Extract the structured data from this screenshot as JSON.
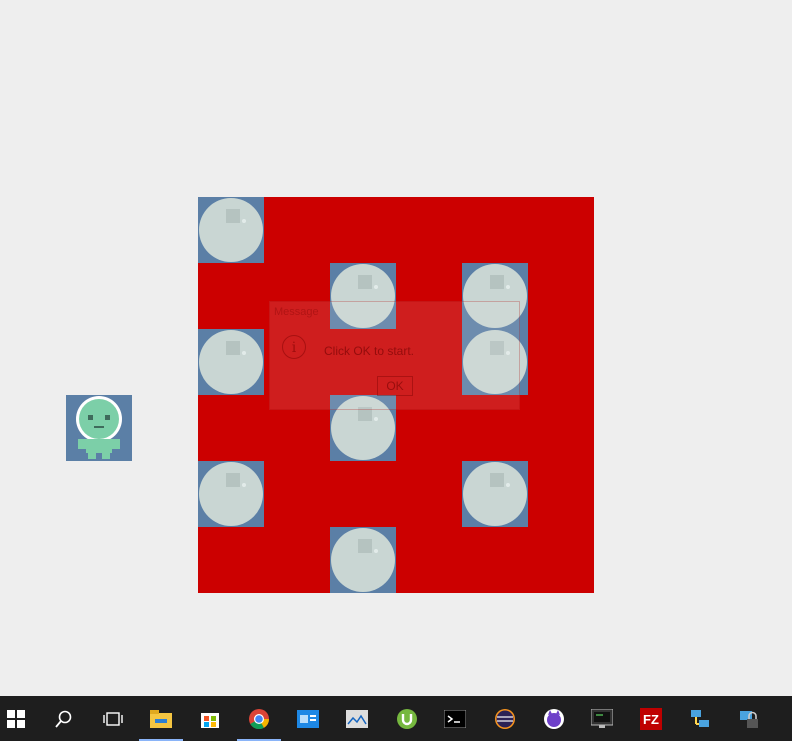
{
  "game": {
    "player_icon": "astronaut-icon",
    "rock_icon": "moon-rock-icon",
    "colors": {
      "background": "#eeeeee",
      "board": "#cc0000",
      "tile": "#5b7fa6",
      "rock": "#c9d6d3",
      "player": "#7ccfa8"
    },
    "rocks_grid": [
      [
        1,
        0,
        0,
        0,
        0,
        0
      ],
      [
        0,
        0,
        1,
        0,
        1,
        0
      ],
      [
        1,
        0,
        0,
        0,
        1,
        0
      ],
      [
        0,
        0,
        1,
        0,
        0,
        0
      ],
      [
        1,
        0,
        0,
        0,
        1,
        0
      ],
      [
        0,
        0,
        1,
        0,
        0,
        0
      ]
    ]
  },
  "dialog": {
    "title": "Message",
    "message": "Click OK to start.",
    "ok_label": "OK",
    "icon": "info-icon"
  },
  "taskbar": {
    "items": [
      {
        "name": "start-button-windows-icon",
        "active": false
      },
      {
        "name": "search-icon",
        "active": false
      },
      {
        "name": "task-view-icon",
        "active": false
      },
      {
        "name": "file-explorer-icon",
        "active": true
      },
      {
        "name": "store-icon",
        "active": false
      },
      {
        "name": "chrome-icon",
        "active": true
      },
      {
        "name": "contacts-app-icon",
        "active": false
      },
      {
        "name": "photo-viewer-icon",
        "active": false
      },
      {
        "name": "utorrent-icon",
        "active": false
      },
      {
        "name": "command-prompt-icon",
        "active": false
      },
      {
        "name": "eclipse-icon",
        "active": false
      },
      {
        "name": "github-desktop-icon",
        "active": false
      },
      {
        "name": "terminal-monitor-icon",
        "active": false
      },
      {
        "name": "filezilla-icon",
        "active": false
      },
      {
        "name": "network-connections-icon",
        "active": false
      },
      {
        "name": "vpn-lock-icon",
        "active": false
      }
    ]
  }
}
